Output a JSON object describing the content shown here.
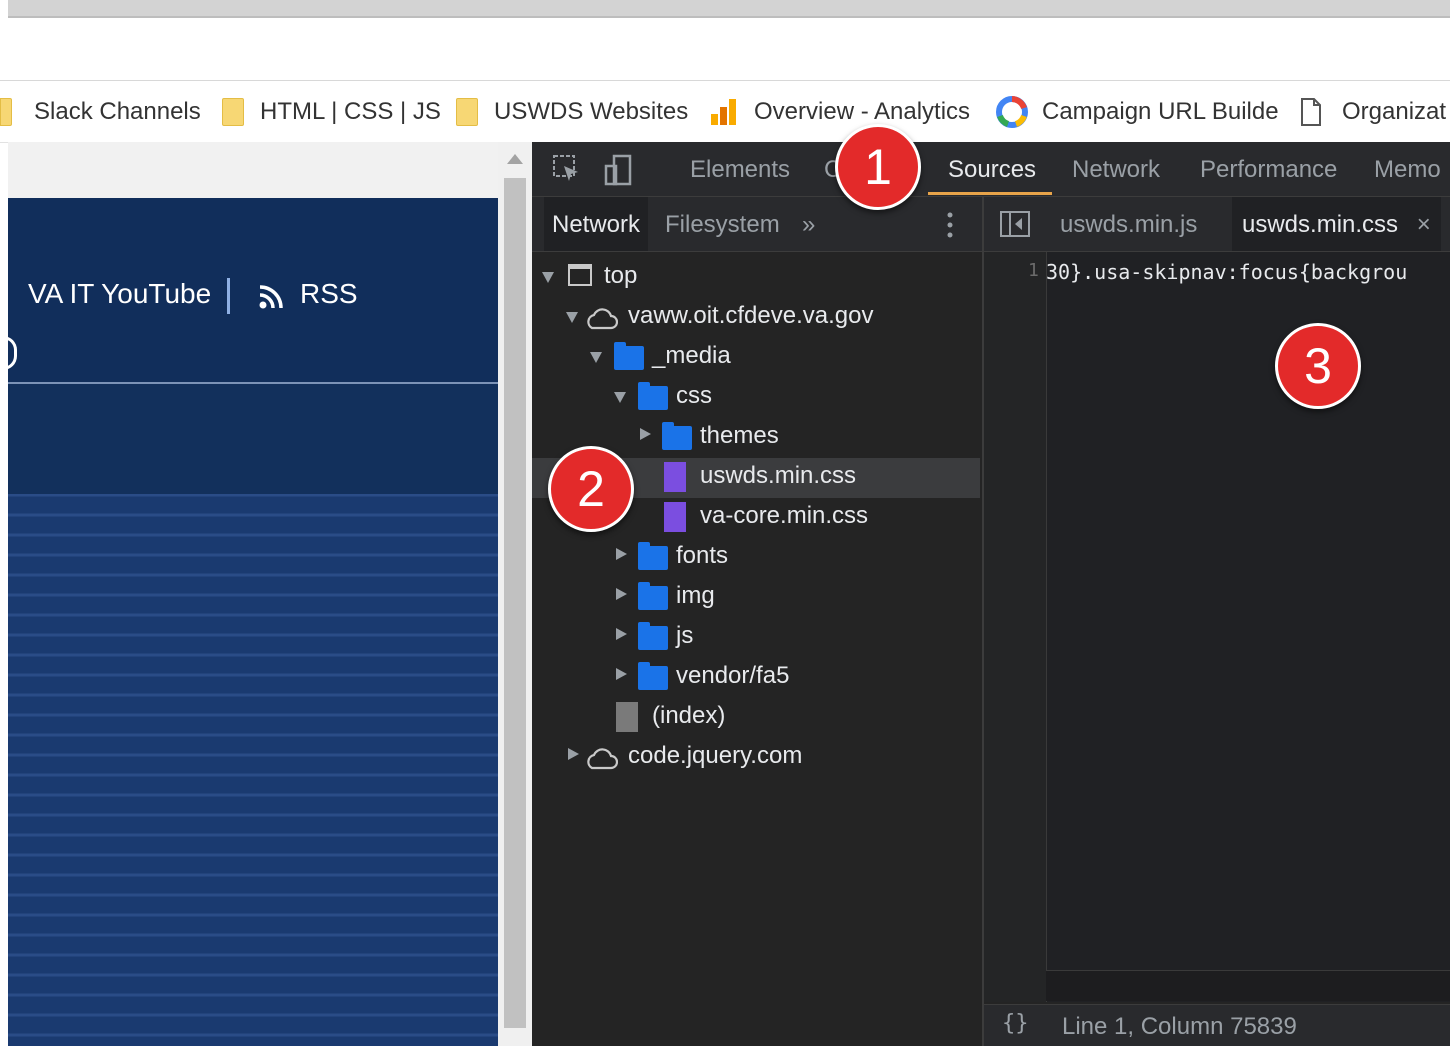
{
  "bookmarks": [
    {
      "label": "Slack Channels",
      "icon": "folder-icon"
    },
    {
      "label": "HTML | CSS | JS",
      "icon": "folder-icon"
    },
    {
      "label": "USWDS Websites",
      "icon": "folder-icon"
    },
    {
      "label": "Overview - Analytics",
      "icon": "analytics-icon"
    },
    {
      "label": "Campaign URL Builde",
      "icon": "google-icon"
    },
    {
      "label": "Organizat",
      "icon": "document-icon"
    }
  ],
  "page": {
    "youtube_label": "VA IT YouTube",
    "rss_label": "RSS"
  },
  "devtools": {
    "tabs": [
      {
        "label": "Elements"
      },
      {
        "label": "C"
      },
      {
        "label": "Sources",
        "active": true
      },
      {
        "label": "Network"
      },
      {
        "label": "Performance"
      },
      {
        "label": "Memo"
      }
    ],
    "navigator_tabs": [
      {
        "label": "Network",
        "active": true
      },
      {
        "label": "Filesystem"
      }
    ],
    "more_tabs": "»",
    "tree": [
      {
        "label": "top",
        "icon": "frame-icon",
        "expanded": true
      },
      {
        "label": "vaww.oit.cfdeve.va.gov",
        "icon": "cloud-icon",
        "expanded": true
      },
      {
        "label": "_media",
        "icon": "folder-icon",
        "expanded": true
      },
      {
        "label": "css",
        "icon": "folder-icon",
        "expanded": true
      },
      {
        "label": "themes",
        "icon": "folder-icon",
        "expanded": false
      },
      {
        "label": "uswds.min.css",
        "icon": "css-file-icon",
        "selected": true
      },
      {
        "label": "va-core.min.css",
        "icon": "css-file-icon"
      },
      {
        "label": "fonts",
        "icon": "folder-icon",
        "expanded": false
      },
      {
        "label": "img",
        "icon": "folder-icon",
        "expanded": false
      },
      {
        "label": "js",
        "icon": "folder-icon",
        "expanded": false
      },
      {
        "label": "vendor/fa5",
        "icon": "folder-icon",
        "expanded": false
      },
      {
        "label": "(index)",
        "icon": "document-icon"
      },
      {
        "label": "code.jquery.com",
        "icon": "cloud-icon",
        "expanded": false
      }
    ],
    "editor_tabs": [
      {
        "label": "uswds.min.js"
      },
      {
        "label": "uswds.min.css",
        "active": true,
        "close": "×"
      }
    ],
    "line_number": "1",
    "code_line": "30}.usa-skipnav:focus{backgrou",
    "status_braces": "{}",
    "status_position": "Line 1, Column 75839"
  },
  "callouts": [
    "1",
    "2",
    "3"
  ],
  "colors": {
    "callout": "#e32a2a",
    "devtools_bg": "#242424",
    "page_navy": "#112e5b",
    "active_tab_underline": "#e8a44a",
    "folder_blue": "#1a73e8",
    "css_file_purple": "#7b4ee0"
  }
}
